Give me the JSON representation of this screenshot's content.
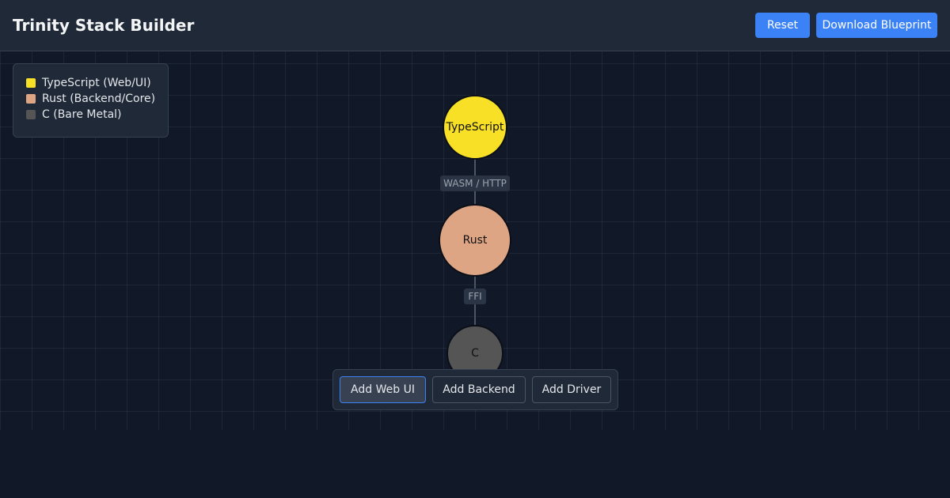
{
  "header": {
    "title": "Trinity Stack Builder",
    "reset_label": "Reset",
    "download_label": "Download Blueprint",
    "accent_color": "#3b82f6"
  },
  "legend": {
    "items": [
      {
        "label": "TypeScript (Web/UI)",
        "color": "#f7e025"
      },
      {
        "label": "Rust (Backend/Core)",
        "color": "#dea584"
      },
      {
        "label": "C (Bare Metal)",
        "color": "#555555"
      }
    ]
  },
  "graph": {
    "nodes": [
      {
        "label": "TypeScript",
        "color": "#f7e025"
      },
      {
        "label": "Rust",
        "color": "#dea584"
      },
      {
        "label": "C",
        "color": "#555555"
      }
    ],
    "edges": [
      {
        "label": "WASM / HTTP"
      },
      {
        "label": "FFI"
      }
    ]
  },
  "toolbar": {
    "buttons": [
      {
        "label": "Add Web UI",
        "active": true
      },
      {
        "label": "Add Backend",
        "active": false
      },
      {
        "label": "Add Driver",
        "active": false
      }
    ]
  }
}
